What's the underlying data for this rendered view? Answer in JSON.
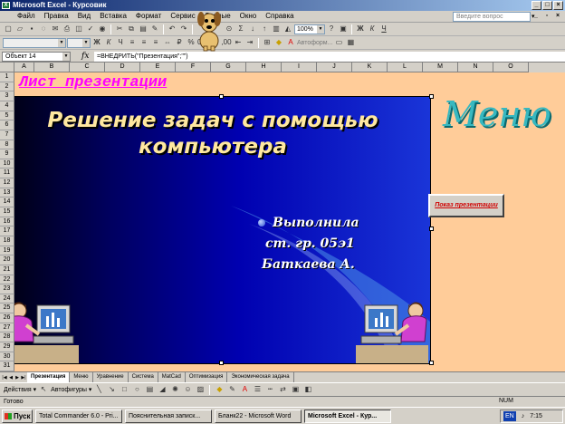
{
  "window": {
    "title": "Microsoft Excel - Курсовик",
    "app_icon": "excel-icon"
  },
  "menu": {
    "items": [
      "Файл",
      "Правка",
      "Вид",
      "Вставка",
      "Формат",
      "Сервис",
      "Данные",
      "Окно",
      "Справка"
    ],
    "ask_placeholder": "Введите вопрос"
  },
  "toolbar": {
    "zoom": "100%",
    "font_name": "Автоформат",
    "hint": "Автоформ..."
  },
  "formula_bar": {
    "name_box": "Объект 14",
    "fx_label": "fx",
    "formula": "=ВНЕДРИТЬ(\"Презентация\";\"\")"
  },
  "columns": [
    "A",
    "B",
    "C",
    "D",
    "E",
    "F",
    "G",
    "H",
    "I",
    "J",
    "K",
    "L",
    "M",
    "N",
    "O"
  ],
  "rows": [
    "1",
    "2",
    "3",
    "4",
    "5",
    "6",
    "7",
    "8",
    "9",
    "10",
    "11",
    "12",
    "13",
    "14",
    "15",
    "16",
    "17",
    "18",
    "19",
    "20",
    "21",
    "22",
    "23",
    "24",
    "25",
    "26",
    "27",
    "28",
    "29",
    "30",
    "31"
  ],
  "sheet": {
    "heading": "Лист презентации",
    "menu_title": "Меню",
    "show_button": "Показ презентации"
  },
  "slide": {
    "title_line1": "Решение задач с помощью",
    "title_line2": "компьютера",
    "line1": "Выполнила",
    "line2": "ст. гр. 05э1",
    "line3": "Баткаева А."
  },
  "tabs": [
    "Презентация",
    "Меню",
    "Уравнение",
    "Система",
    "MatCad",
    "Оптимизация",
    "Экономическая задача"
  ],
  "drawing": {
    "actions": "Действия ▾",
    "autoshapes": "Автофигуры ▾"
  },
  "status": {
    "ready": "Готово",
    "num": "NUM"
  },
  "taskbar": {
    "start": "Пуск",
    "tasks": [
      "Total Commander 6.0 - Pri...",
      "Пояснительная записк...",
      "Бланк22 - Microsoft Word",
      "Microsoft Excel - Кур..."
    ],
    "lang": "EN",
    "time": "7:15"
  }
}
